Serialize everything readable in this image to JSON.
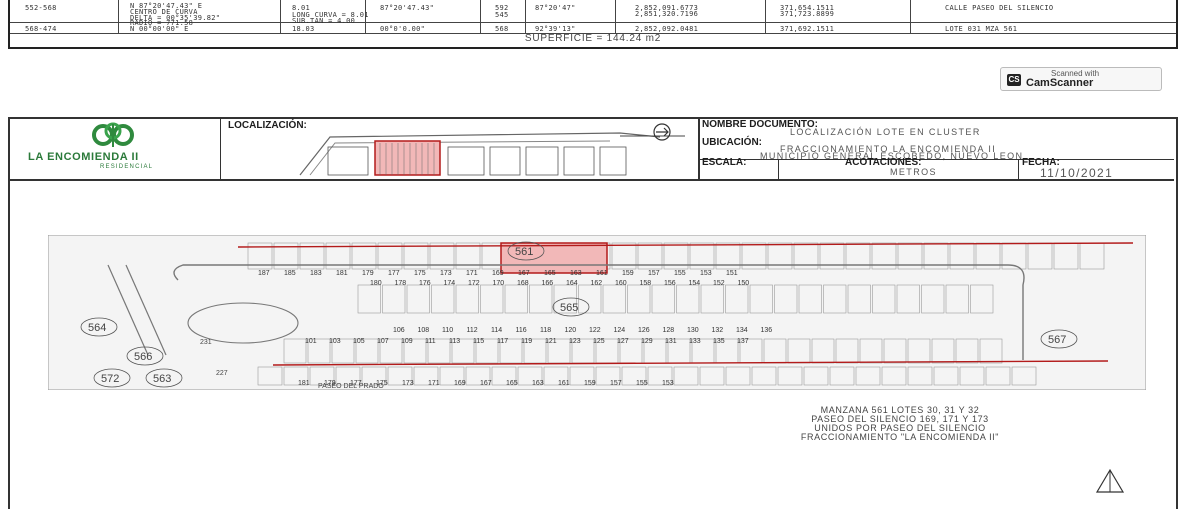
{
  "top_table": {
    "rows": [
      [
        "552-568",
        "N 87°20'47.43\" E",
        "8.01",
        "87°20'47.43\"",
        "592",
        "87°20'47\"",
        "2,852,091.6773",
        "371,654.1511",
        "CALLE PASEO DEL SILENCIO"
      ],
      [
        "",
        "CENTRO DE CURVA",
        "LONG CURVA = 8.01",
        "",
        "545",
        "",
        "2,851,320.7196",
        "371,723.8899",
        ""
      ],
      [
        "",
        "DELTA = 00°35'39.82\"",
        "SUB.TAN = 4.00",
        "",
        "",
        "",
        "",
        "",
        ""
      ],
      [
        "",
        "RADIO = 771.58",
        "",
        "",
        "",
        "",
        "",
        "",
        ""
      ],
      [
        "568-474",
        "N 00°00'00\" E",
        "18.03",
        "00°0'0.00\"",
        "568",
        "92°39'13\"",
        "2,852,092.0481",
        "371,692.1511",
        "LOTE 031 MZA 561"
      ]
    ],
    "superficie": "SUPERFICIE = 144.24 m2"
  },
  "camscanner": {
    "line1": "Scanned with",
    "line2": "CamScanner",
    "logo": "CS"
  },
  "header": {
    "logo_text": "LA ENCOMIENDA II",
    "logo_sub": "RESIDENCIAL",
    "localizacion_label": "LOCALIZACIÓN:",
    "nombre_label": "NOMBRE DOCUMENTO:",
    "nombre_value": "LOCALIZACIÓN LOTE EN CLUSTER",
    "ubicacion_label": "UBICACIÓN:",
    "ubicacion_line1": "FRACCIONAMIENTO LA ENCOMIENDA II",
    "ubicacion_line2": "MUNICIPIO GENERAL ESCOBEDO, NUEVO LEON.",
    "escala_label": "ESCALA:",
    "acotaciones_label": "ACOTACIONES:",
    "acotaciones_value": "METROS",
    "fecha_label": "FECHA:",
    "fecha_value": "11/10/2021"
  },
  "map": {
    "top_row_labels": [
      "187",
      "185",
      "183",
      "181",
      "179",
      "177",
      "175",
      "173",
      "171",
      "169",
      "167",
      "165",
      "163",
      "161",
      "159",
      "157",
      "155",
      "153",
      "151"
    ],
    "row2_labels": [
      "180",
      "178",
      "176",
      "174",
      "172",
      "170",
      "168",
      "166",
      "164",
      "162",
      "160",
      "158",
      "156",
      "154",
      "152",
      "150"
    ],
    "row3_labels": [
      "106",
      "108",
      "110",
      "112",
      "114",
      "116",
      "118",
      "120",
      "122",
      "124",
      "126",
      "128",
      "130",
      "132",
      "134",
      "136"
    ],
    "row4_labels": [
      "101",
      "103",
      "105",
      "107",
      "109",
      "111",
      "113",
      "115",
      "117",
      "119",
      "121",
      "123",
      "125",
      "127",
      "129",
      "131",
      "133",
      "135",
      "137"
    ],
    "bottom_row_labels": [
      "181",
      "179",
      "177",
      "175",
      "173",
      "171",
      "169",
      "167",
      "165",
      "163",
      "161",
      "159",
      "157",
      "155",
      "153"
    ],
    "misc_labels": [
      "231",
      "227"
    ],
    "street_labels": [
      "PASEO DEL PRADO"
    ],
    "block_labels": [
      "561",
      "565",
      "564",
      "566",
      "567",
      "572",
      "563"
    ],
    "highlight_color": "#f2b8b8",
    "line_color": "#b31b1b"
  },
  "legend": {
    "line1": "MANZANA 561 LOTES 30, 31 Y 32",
    "line2": "PASEO DEL SILENCIO 169, 171 Y 173",
    "line3": "UNIDOS POR PASEO DEL SILENCIO",
    "line4": "FRACCIONAMIENTO \"LA ENCOMIENDA II\""
  }
}
